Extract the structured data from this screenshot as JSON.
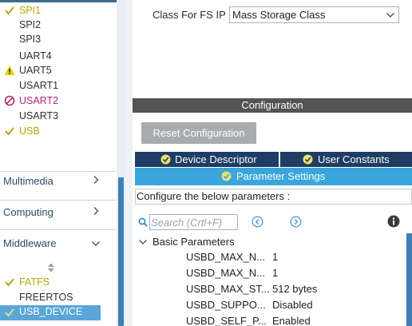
{
  "sidebar": {
    "peripherals": [
      {
        "label": "SPI1",
        "status": "ok",
        "icon": "check-icon"
      },
      {
        "label": "SPI2",
        "status": "normal",
        "icon": ""
      },
      {
        "label": "SPI3",
        "status": "normal",
        "icon": ""
      },
      {
        "label": "UART4",
        "status": "normal",
        "icon": ""
      },
      {
        "label": "UART5",
        "status": "warning",
        "icon": "warning-icon"
      },
      {
        "label": "USART1",
        "status": "normal",
        "icon": ""
      },
      {
        "label": "USART2",
        "status": "error",
        "icon": "disabled-icon"
      },
      {
        "label": "USART3",
        "status": "normal",
        "icon": ""
      },
      {
        "label": "USB",
        "status": "ok",
        "icon": "check-icon"
      }
    ],
    "categories": [
      {
        "label": "Multimedia",
        "icon": "chevron-right-icon"
      },
      {
        "label": "Computing",
        "icon": "chevron-right-icon"
      },
      {
        "label": "Middleware",
        "icon": "chevron-down-icon"
      }
    ],
    "middleware_items": [
      {
        "label": "FATFS",
        "status": "ok",
        "icon": "check-icon"
      },
      {
        "label": "FREERTOS",
        "status": "normal",
        "icon": ""
      },
      {
        "label": "USB_DEVICE",
        "status": "selected-ok",
        "icon": "check-icon"
      }
    ]
  },
  "fs_ip": {
    "label": "Class For FS IP",
    "value": "Mass Storage Class"
  },
  "configuration": {
    "title": "Configuration",
    "reset_label": "Reset Configuration",
    "tabs": {
      "device_descriptor": "Device Descriptor",
      "user_constants": "User Constants",
      "parameter_settings": "Parameter Settings"
    },
    "instructions": "Configure the below parameters :",
    "search_placeholder": "Search (Crtl+F)",
    "group_label": "Basic Parameters",
    "params": [
      {
        "name": "USBD_MAX_N...",
        "value": "1"
      },
      {
        "name": "USBD_MAX_N...",
        "value": "1"
      },
      {
        "name": "USBD_MAX_ST...",
        "value": "512 bytes"
      },
      {
        "name": "USBD_SUPPO...",
        "value": "Disabled"
      },
      {
        "name": "USBD_SELF_P...",
        "value": "Enabled"
      }
    ]
  },
  "colors": {
    "ok": "#b5a800",
    "error": "#b3276b",
    "tab_dark": "#1f3d63",
    "tab_active": "#3aa6dc",
    "header": "#535353",
    "selected_row": "#5aa6d8"
  }
}
